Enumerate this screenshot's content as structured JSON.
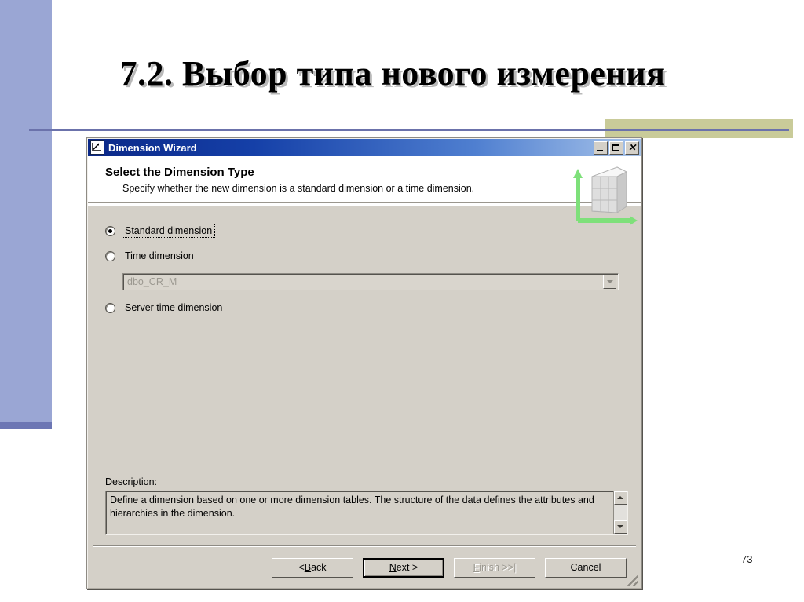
{
  "slide": {
    "title": "7.2. Выбор типа нового измерения",
    "page_number": "73",
    "accent_bar_color": "#9aa6d4",
    "accent_block_color": "#c9cb99",
    "rule_color": "#6b72ab"
  },
  "dialog": {
    "titlebar": {
      "title": "Dimension Wizard",
      "icon": "dimension-wizard-icon",
      "minimize_label": "Minimize",
      "maximize_label": "Maximize",
      "close_label": "Close"
    },
    "header": {
      "title": "Select the Dimension Type",
      "subtitle": "Specify whether the new dimension is a standard dimension or a time dimension.",
      "art_icon": "dimension-cube-axes-icon",
      "art_axis_color": "#7ee07a"
    },
    "options": {
      "items": [
        {
          "label": "Standard dimension",
          "checked": true,
          "focused": true
        },
        {
          "label": "Time dimension",
          "checked": false,
          "focused": false
        },
        {
          "label": "Server time dimension",
          "checked": false,
          "focused": false
        }
      ]
    },
    "time_table_combo": {
      "value": "dbo_CR_M",
      "disabled": true,
      "arrow_icon": "chevron-down-icon"
    },
    "description": {
      "label": "Description:",
      "text": "Define a dimension based on one or more dimension tables. The structure of the data defines the attributes and hierarchies in the dimension.",
      "scroll_up_icon": "scroll-up-arrow-icon",
      "scroll_down_icon": "scroll-down-arrow-icon"
    },
    "buttons": [
      {
        "pre": "< ",
        "accel": "B",
        "post": "ack",
        "state": "normal"
      },
      {
        "pre": "",
        "accel": "N",
        "post": "ext >",
        "state": "default"
      },
      {
        "pre": "",
        "accel": "F",
        "post": "inish >>|",
        "state": "disabled"
      },
      {
        "pre": "",
        "accel": "",
        "post": "Cancel",
        "state": "normal"
      }
    ],
    "resize_grip": "resize-grip-icon"
  }
}
